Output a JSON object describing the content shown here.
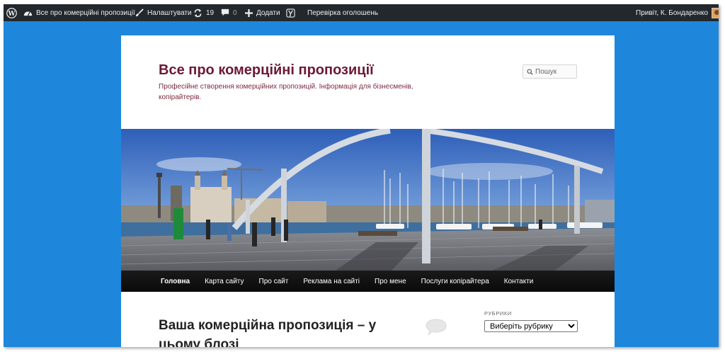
{
  "admin_bar": {
    "site_name": "Все про комерційні пропозиції",
    "customize": "Налаштувати",
    "updates_count": "19",
    "comments_count": "0",
    "add_new": "Додати",
    "ad_check": "Перевірка оголошень",
    "greeting": "Привіт, К. Бондаренко"
  },
  "header": {
    "title": "Все про комерційні пропозиції",
    "description": "Професійне створення комерційних пропозицій. Інформація для бізнесменів, копірайтерів.",
    "search_placeholder": "Пошук"
  },
  "nav": {
    "items": [
      "Головна",
      "Карта сайту",
      "Про сайт",
      "Реклама на сайті",
      "Про мене",
      "Послуги копірайтера",
      "Контакти"
    ]
  },
  "post": {
    "title": "Ваша комерційна пропозиція – у цьому блозі"
  },
  "sidebar": {
    "widget_title": "РУБРИКИ",
    "select_value": "Виберіть рубрику"
  },
  "colors": {
    "frame_bg": "#1e87db",
    "admin_bar_bg": "#23282d",
    "title_color": "#6b1a35",
    "nav_bg": "#111111"
  },
  "icons": [
    "wordpress-icon",
    "dashboard-icon",
    "brush-icon",
    "update-icon",
    "comment-icon",
    "plus-icon",
    "yoast-icon",
    "search-icon",
    "comment-bubble-icon"
  ]
}
